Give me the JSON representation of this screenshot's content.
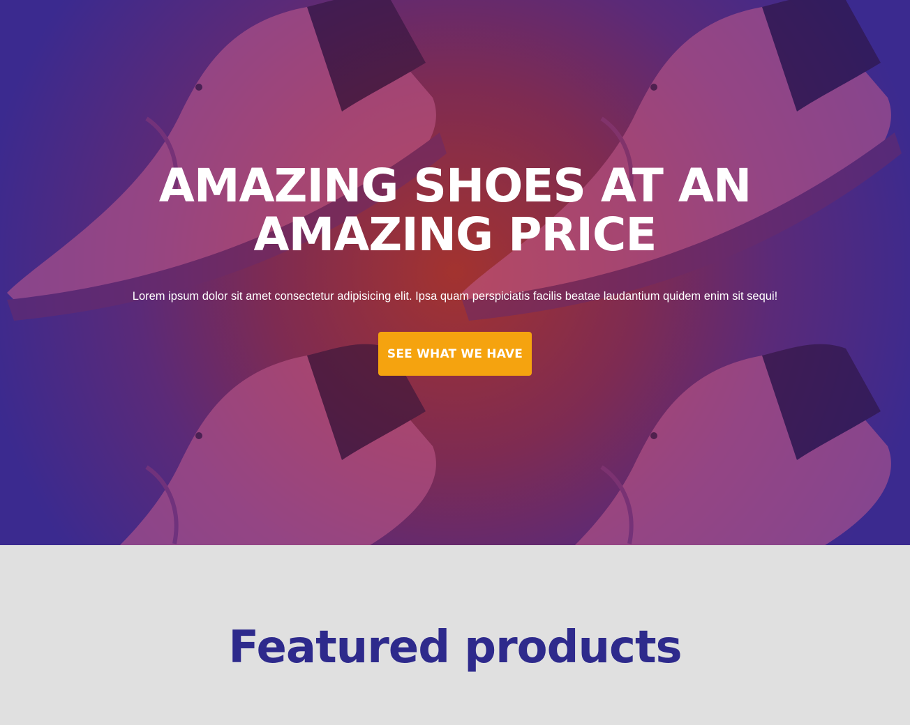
{
  "hero": {
    "title": "AMAZING SHOES AT AN AMAZING PRICE",
    "subtitle": "Lorem ipsum dolor sit amet consectetur adipisicing elit. Ipsa quam perspiciatis facilis beatae laudantium quidem enim sit sequi!",
    "cta_label": "SEE WHAT WE HAVE",
    "background_image": "sneaker-pattern",
    "colors": {
      "overlay_center": "#a3332f",
      "overlay_edge": "#3b2a8f",
      "cta": "#f5a30f",
      "text": "#ffffff"
    }
  },
  "featured": {
    "title": "Featured products",
    "colors": {
      "title": "#2e2a8c",
      "background": "#e0e0e0"
    }
  }
}
